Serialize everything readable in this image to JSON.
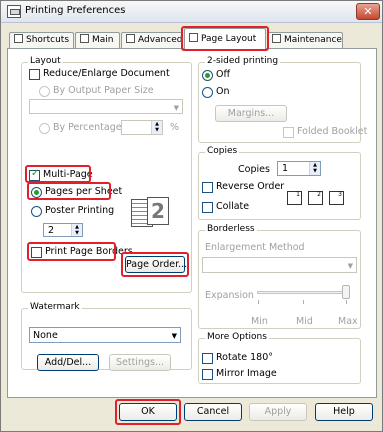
{
  "window": {
    "title": "Printing Preferences",
    "close_glyph": "✕"
  },
  "tabs": [
    {
      "label": "Shortcuts",
      "icon": "shortcuts-icon"
    },
    {
      "label": "Main",
      "icon": "main-icon"
    },
    {
      "label": "Advanced",
      "icon": "advanced-icon"
    },
    {
      "label": "Page Layout",
      "icon": "page-layout-icon",
      "active": true
    },
    {
      "label": "Maintenance",
      "icon": "maintenance-icon"
    }
  ],
  "layout": {
    "group_label": "Layout",
    "reduce_enlarge_label": "Reduce/Enlarge Document",
    "by_output_paper_size_label": "By Output Paper Size",
    "by_percentage_label": "By Percentage",
    "percent_sign": "%",
    "multi_page_label": "Multi-Page",
    "multi_page_checked": true,
    "pages_per_sheet_label": "Pages per Sheet",
    "poster_printing_label": "Poster Printing",
    "pages_value": "2",
    "preview_number": "2",
    "print_page_borders_label": "Print Page Borders",
    "page_order_button": "Page Order..."
  },
  "two_sided": {
    "group_label": "2-sided printing",
    "off_label": "Off",
    "on_label": "On",
    "selected": "Off",
    "margins_button": "Margins...",
    "folded_booklet_label": "Folded Booklet"
  },
  "copies": {
    "group_label": "Copies",
    "copies_label": "Copies",
    "copies_value": "1",
    "reverse_order_label": "Reverse Order",
    "collate_label": "Collate",
    "collate_pages": [
      "1",
      "2",
      "3"
    ]
  },
  "borderless": {
    "group_label": "Borderless",
    "enlargement_method_label": "Enlargement Method",
    "expansion_label": "Expansion",
    "scale_min": "Min",
    "scale_mid": "Mid",
    "scale_max": "Max"
  },
  "watermark": {
    "group_label": "Watermark",
    "selected": "None",
    "add_del_button": "Add/Del...",
    "settings_button": "Settings..."
  },
  "more_options": {
    "group_label": "More Options",
    "rotate_label": "Rotate 180°",
    "mirror_label": "Mirror Image"
  },
  "footer": {
    "ok": "OK",
    "cancel": "Cancel",
    "apply": "Apply",
    "help": "Help"
  }
}
